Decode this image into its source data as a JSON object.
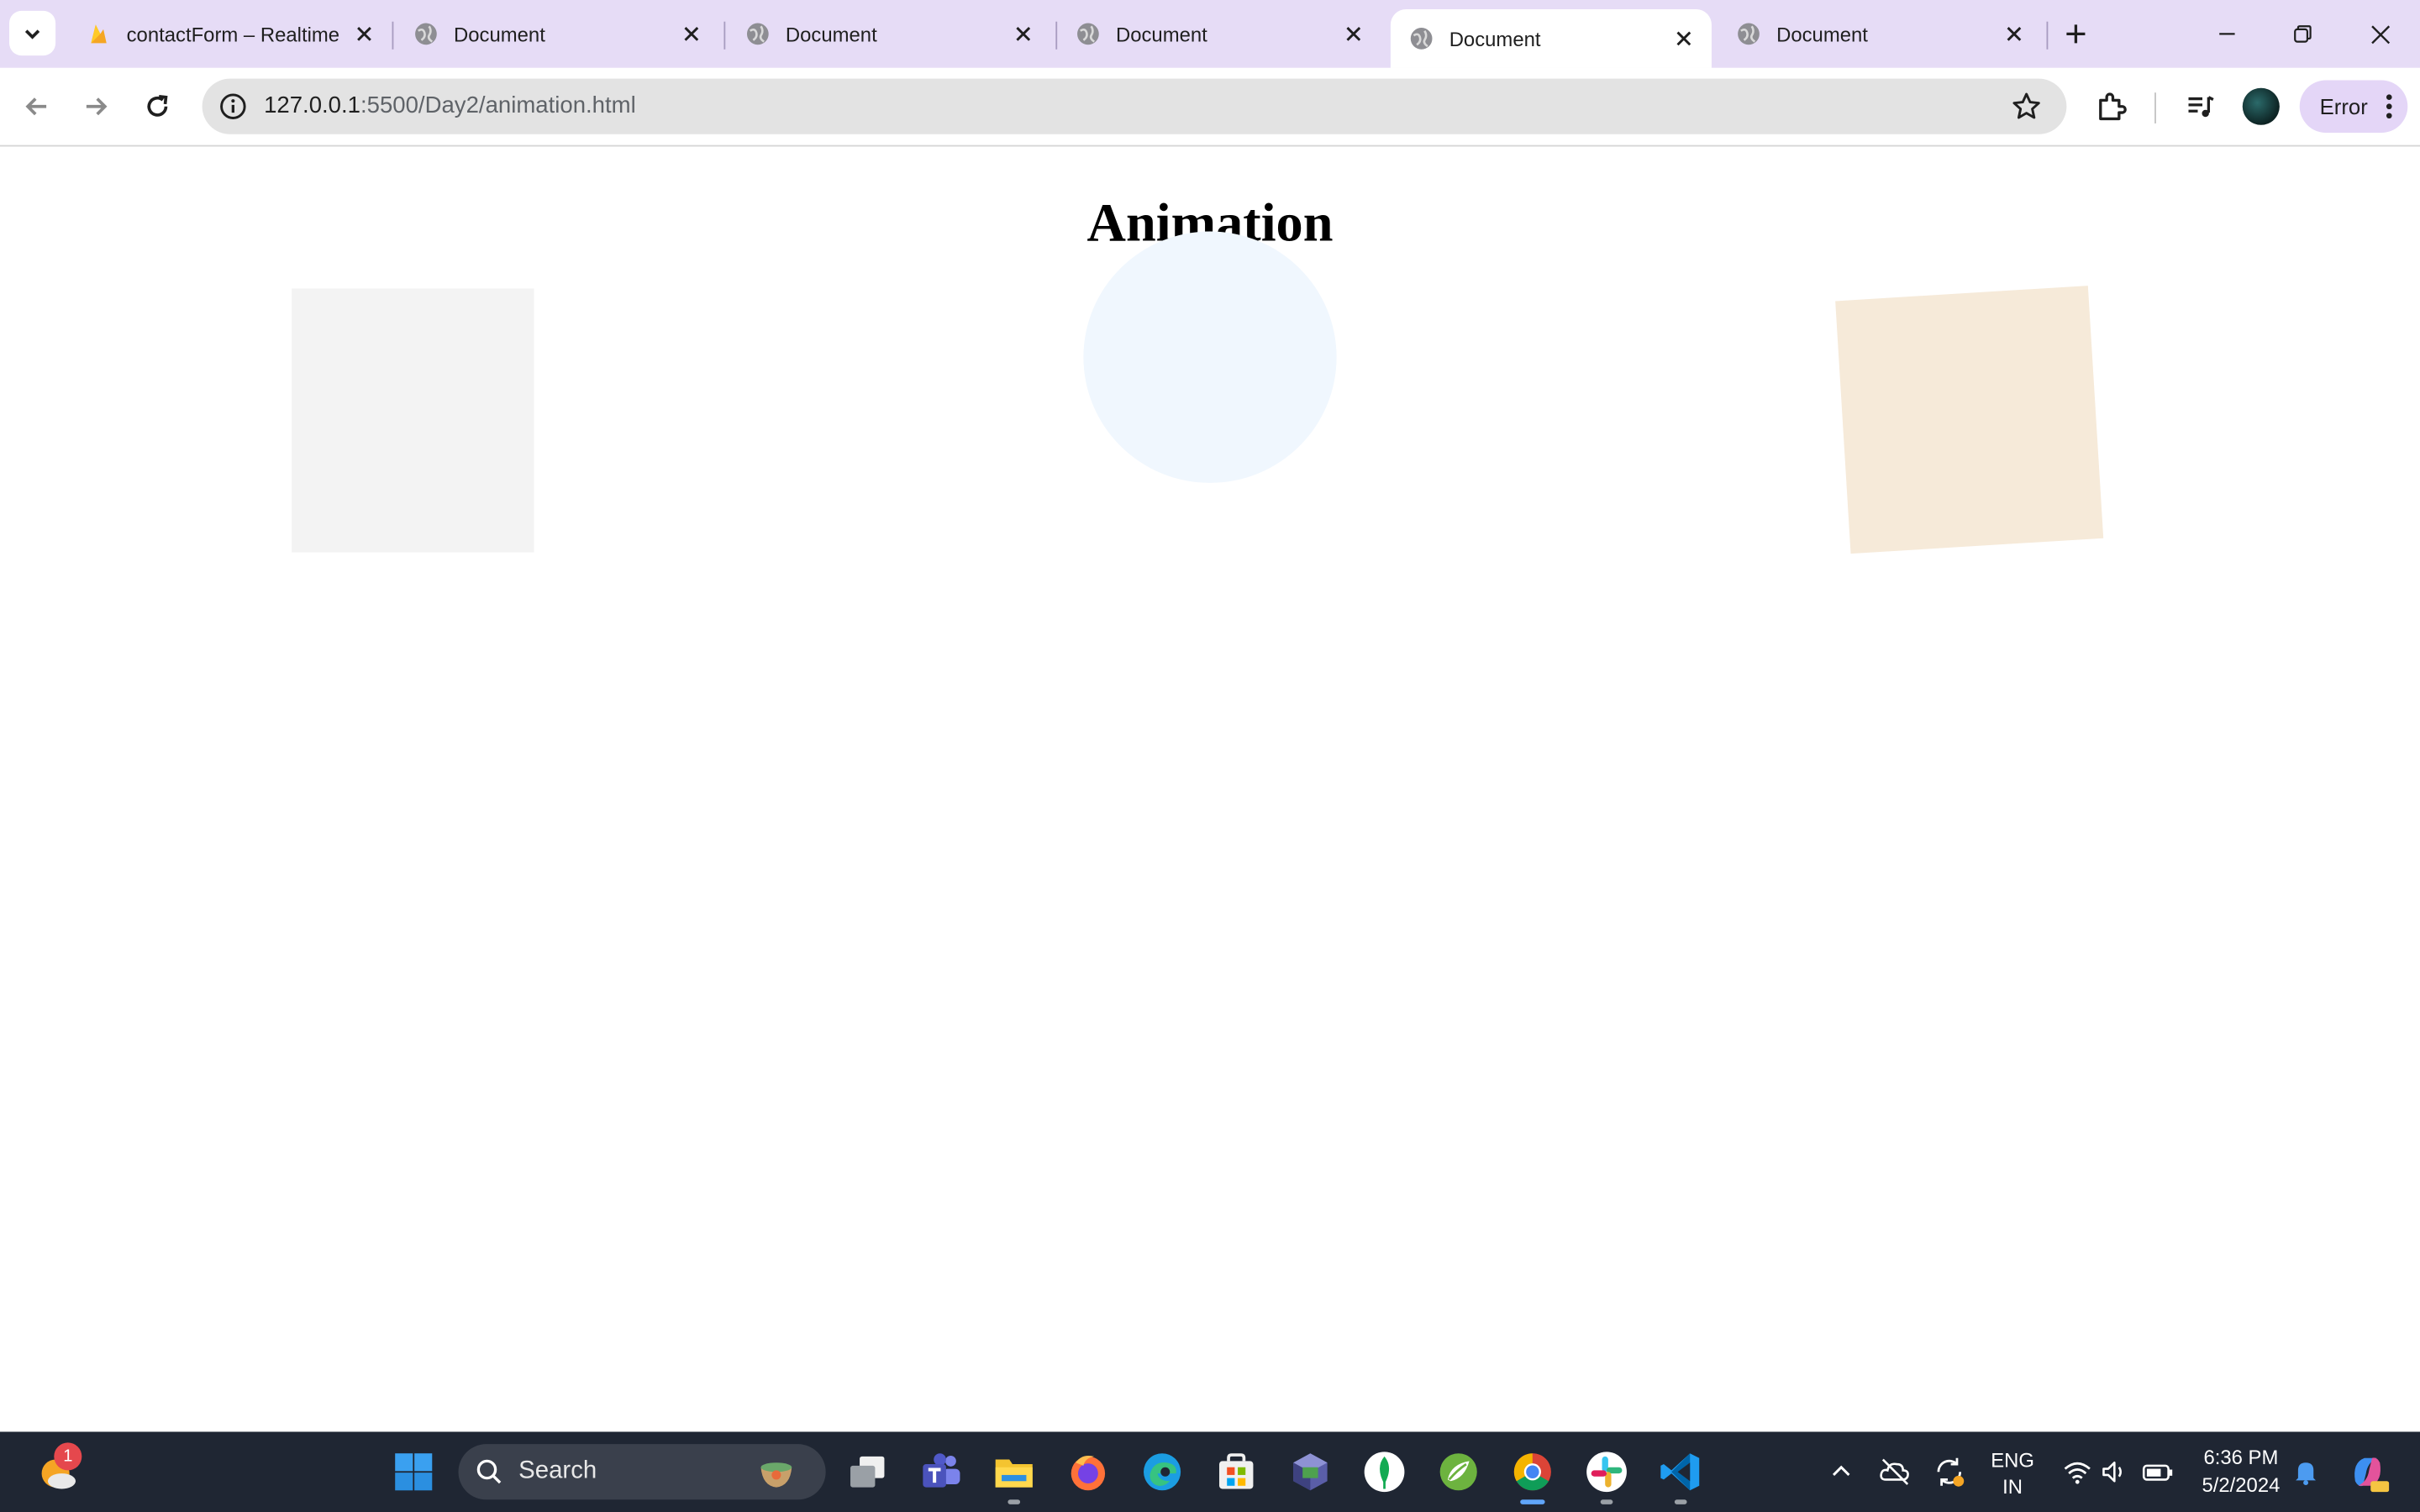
{
  "browser": {
    "tabs": [
      {
        "title": "contactForm – Realtime",
        "icon": "firebase-icon",
        "active": false
      },
      {
        "title": "Document",
        "icon": "globe-icon",
        "active": false
      },
      {
        "title": "Document",
        "icon": "globe-icon",
        "active": false
      },
      {
        "title": "Document",
        "icon": "globe-icon",
        "active": false
      },
      {
        "title": "Document",
        "icon": "globe-icon",
        "active": true
      },
      {
        "title": "Document",
        "icon": "globe-icon",
        "active": false
      }
    ],
    "address": {
      "host": "127.0.0.1",
      "path": ":5500/Day2/animation.html"
    },
    "error_label": "Error"
  },
  "page": {
    "title": "Animation",
    "shapes": [
      {
        "name": "square",
        "color": "#f3f3f3"
      },
      {
        "name": "circle",
        "color": "#f0f7fe"
      },
      {
        "name": "rotated-square",
        "color": "#f6ead9"
      }
    ]
  },
  "taskbar": {
    "weather_badge": "1",
    "search_placeholder": "Search",
    "apps": [
      "windows-start-icon",
      "task-view-icon",
      "teams-icon",
      "file-explorer-icon",
      "firefox-icon",
      "edge-icon",
      "microsoft-store-icon",
      "virtualbox-icon",
      "mongodb-icon",
      "spring-icon",
      "chrome-icon",
      "slack-icon",
      "vscode-icon"
    ],
    "language": {
      "line1": "ENG",
      "line2": "IN"
    },
    "time": "6:36 PM",
    "date": "5/2/2024"
  },
  "colors": {
    "tabstrip": "#e6dcf6",
    "accent": "#60a5fa",
    "taskbar": "#1f2633"
  }
}
